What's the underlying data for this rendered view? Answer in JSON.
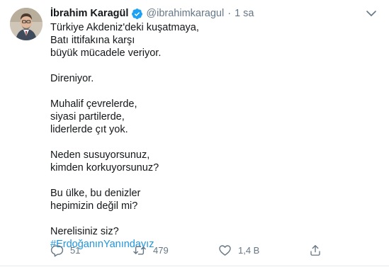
{
  "tweet": {
    "author": {
      "name": "İbrahim Karagül",
      "handle": "@ibrahimkaragul",
      "verified": true,
      "separator": "·",
      "time": "1 sa"
    },
    "lines": [
      "Türkiye Akdeniz'deki kuşatmaya,",
      "Batı ittifakına karşı",
      "büyük mücadele veriyor.",
      "",
      "Direniyor.",
      "",
      "Muhalif çevrelerde,",
      "siyasi partilerde,",
      "liderlerde çıt yok.",
      "",
      "Neden susuyorsunuz,",
      "kimden korkuyorsunuz?",
      "",
      "Bu ülke, bu denizler",
      "hepimizin değil mi?",
      "",
      "Nerelisiniz siz?"
    ],
    "hashtag": "#ErdoğanınYanındayız",
    "actions": {
      "reply": {
        "icon": "reply-icon",
        "count": "51"
      },
      "retweet": {
        "icon": "retweet-icon",
        "count": "479"
      },
      "like": {
        "icon": "heart-icon",
        "count": "1,4 B"
      },
      "share": {
        "icon": "share-icon"
      }
    },
    "colors": {
      "text": "#14171a",
      "secondary": "#657786",
      "link": "#1b95e0",
      "verified": "#1da1f2"
    }
  }
}
